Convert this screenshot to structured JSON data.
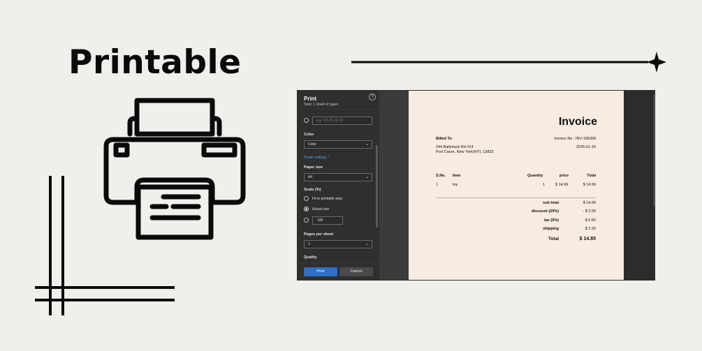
{
  "headline": "Printable",
  "dialog": {
    "title": "Print",
    "subtitle": "Total: 1 sheet of paper",
    "help_icon": "question-icon",
    "pages_placeholder": "e.g. 1-5, 8, 11-13",
    "color_label": "Color",
    "color_value": "Color",
    "fewer_settings": "Fewer settings",
    "paper_size_label": "Paper size",
    "paper_size_value": "A4",
    "scale_label": "Scale (%)",
    "scale_fit": "Fit to printable area",
    "scale_actual": "Actual size",
    "scale_custom_value": "100",
    "pages_per_sheet_label": "Pages per sheet",
    "pages_per_sheet_value": "1",
    "quality_label": "Quality",
    "print_button": "Print",
    "cancel_button": "Cancel",
    "chevron": "⌄",
    "accent": "#2f6fc6"
  },
  "invoice": {
    "title": "Invoice",
    "billed_to_label": "Billed To",
    "address_line1": "244 Ballyhack Rd #14",
    "address_line2": "Port Crane, New York(NY), 13833",
    "invoice_no": "Invoice No : INV-196358",
    "date": "2025-01-15",
    "columns": {
      "sno": "S.No.",
      "item": "Item",
      "quantity": "Quantity",
      "price": "price",
      "total": "Total"
    },
    "rows": [
      {
        "sno": "1",
        "item": "toy",
        "quantity": "1",
        "price": "$ 14.99",
        "total": "$ 14.99"
      }
    ],
    "summary": {
      "subtotal_label": "sub total",
      "subtotal_value": "$ 14.99",
      "discount_label": "discount (20%)",
      "discount_value": "- $ 2.99",
      "tax_label": "tax (5%)",
      "tax_value": "$ 0.60",
      "shipping_label": "shipping",
      "shipping_value": "$ 2.25",
      "total_label": "Total",
      "total_value": "$ 14.85"
    },
    "paper_color": "#f8ebdf"
  }
}
